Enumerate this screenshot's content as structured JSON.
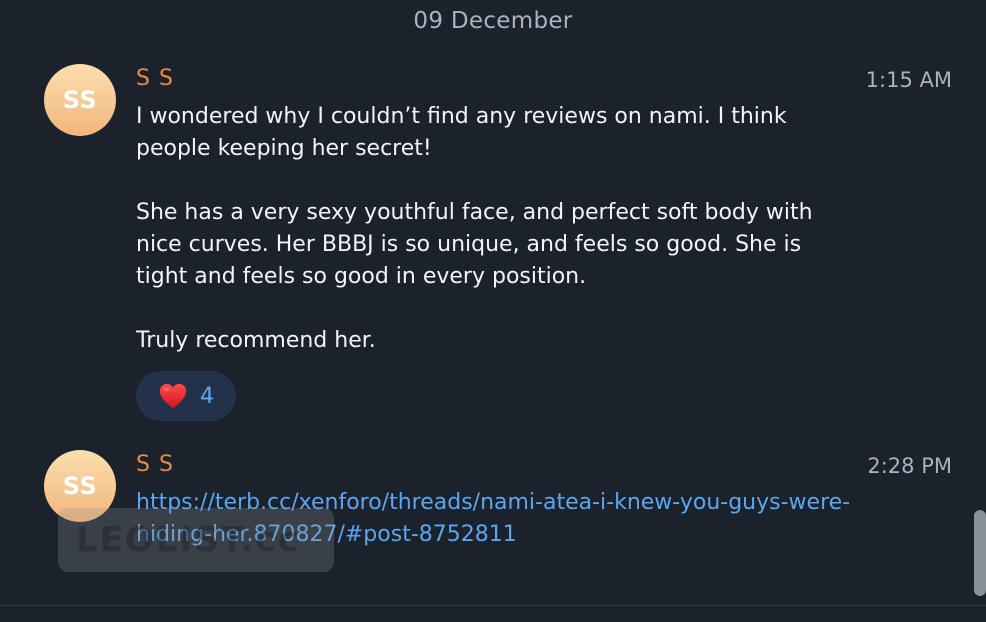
{
  "date_separator": "09 December",
  "messages": [
    {
      "avatar_initials": "SS",
      "sender": "S S",
      "time": "1:15 AM",
      "paragraphs": [
        "I wondered why I couldn’t find any reviews on nami. I think people keeping her secret!",
        "She has a very sexy youthful face, and perfect soft body with nice curves. Her BBBJ is so unique, and feels so good. She is tight and feels so good in every position.",
        "Truly recommend her."
      ],
      "reaction": {
        "icon": "heart-icon",
        "count": "4"
      }
    },
    {
      "avatar_initials": "SS",
      "sender": "S S",
      "time": "2:28 PM",
      "link": "https://terb.cc/xenforo/threads/nami-atea-i-knew-you-guys-were-hiding-her.870827/#post-8752811"
    }
  ],
  "watermark_text": "LEOLIST.cc",
  "colors": {
    "background": "#1b222c",
    "sender": "#e88c43",
    "link": "#5ba6f0",
    "reaction_bg": "#23324a",
    "heart": "#e8202e"
  }
}
